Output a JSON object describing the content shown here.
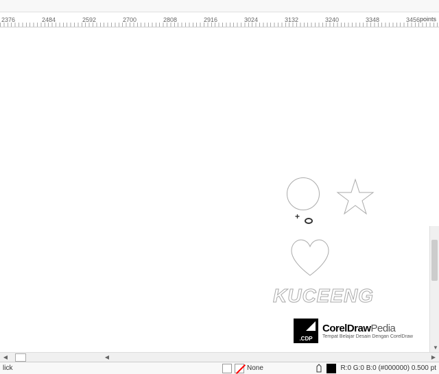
{
  "ruler": {
    "marks": [
      2376,
      2484,
      2592,
      2700,
      2808,
      2916,
      3024,
      3132,
      3240,
      3348,
      3456
    ],
    "unit": "points"
  },
  "canvas": {
    "outline_text": "KUCEENG",
    "cursor_glyph": "+"
  },
  "logo": {
    "square_text": ".CDP",
    "title_a": "Corel",
    "title_b": "Draw",
    "title_c": "Pedia",
    "subtitle": "Tempat Belajar Desain Dengan CorelDraw"
  },
  "status": {
    "left_hint": "lick",
    "fill_label": "None",
    "color_readout": "R:0 G:0 B:0 (#000000)  0.500 pt"
  },
  "scroll": {
    "left_arrow": "◀",
    "right_arrow": "▶",
    "down_arrow": "▼"
  }
}
